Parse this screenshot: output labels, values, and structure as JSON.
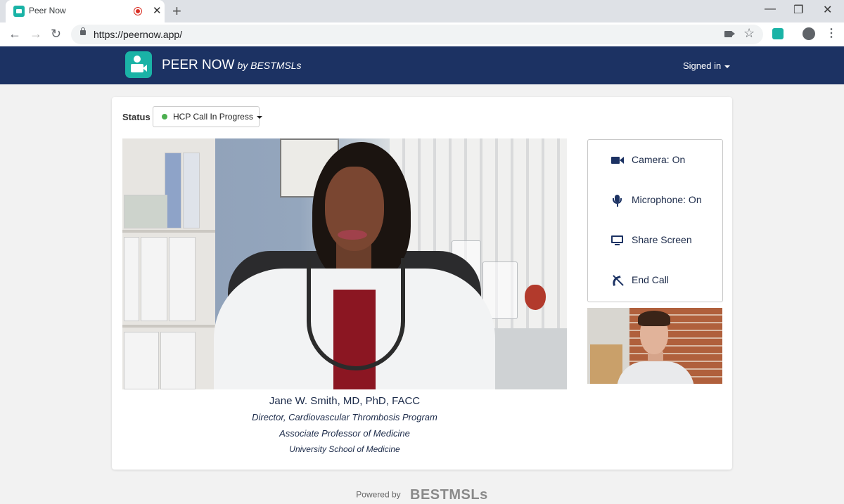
{
  "browser": {
    "tab_title": "Peer Now",
    "url": "https://peernow.app/"
  },
  "app": {
    "brand_name": "PEER NOW",
    "brand_by": "by BESTMSLs",
    "user_menu_label": "Signed in",
    "brand_color": "#1c3263",
    "accent_color": "#1ab3a6"
  },
  "status": {
    "label": "Status",
    "value": "HCP Call In Progress",
    "indicator_color": "#4caf50"
  },
  "controls": [
    {
      "label": "Camera: On",
      "icon": "video-camera-icon"
    },
    {
      "label": "Microphone: On",
      "icon": "microphone-icon"
    },
    {
      "label": "Share Screen",
      "icon": "monitor-icon"
    },
    {
      "label": "End Call",
      "icon": "end-call-icon"
    }
  ],
  "caller": {
    "name": "Jane W. Smith, MD, PhD, FACC",
    "title_1": "Director, Cardiovascular Thrombosis Program",
    "title_2": "Associate Professor of Medicine",
    "school": "University School of Medicine"
  },
  "footer": {
    "powered_by": "Powered by",
    "logo_text": "BESTMSLs"
  }
}
